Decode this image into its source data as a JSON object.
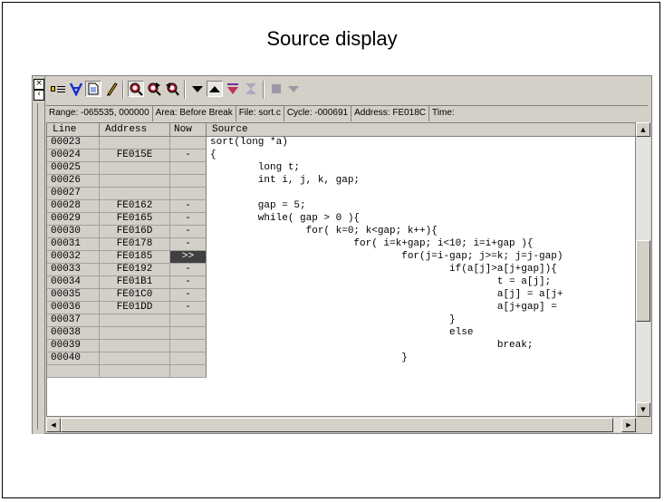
{
  "slide": {
    "title": "Source display"
  },
  "window": {
    "grip": {
      "close_glyph": "×",
      "pin_glyph": "‹"
    },
    "toolbar": {
      "buttons": [
        {
          "icon": "breakpoint-list-icon"
        },
        {
          "icon": "filter-icon"
        },
        {
          "icon": "document-icon"
        },
        {
          "icon": "edit-pencil-icon"
        },
        {
          "icon": "search-icon"
        },
        {
          "icon": "search-forward-icon"
        },
        {
          "icon": "search-back-icon"
        },
        {
          "icon": "arrow-down-icon"
        },
        {
          "icon": "arrow-up-icon"
        },
        {
          "icon": "jump-down-icon"
        },
        {
          "icon": "jump-end-icon"
        },
        {
          "icon": "stop-square-icon"
        },
        {
          "icon": "dropdown-icon"
        }
      ]
    },
    "infobar": {
      "range": "Range: -065535, 000000",
      "area": "Area: Before Break",
      "file": "File: sort.c",
      "cycle": "Cycle: -000691",
      "address": "Address: FE018C",
      "time": "Time:"
    },
    "table": {
      "headers": {
        "line": "Line",
        "address": "Address",
        "now": "Now",
        "source": "Source"
      },
      "rows": [
        {
          "line": "00023",
          "address": "",
          "now": "",
          "source": "sort(long *a)"
        },
        {
          "line": "00024",
          "address": "FE015E",
          "now": "-",
          "source": "{"
        },
        {
          "line": "00025",
          "address": "",
          "now": "",
          "source": "        long t;"
        },
        {
          "line": "00026",
          "address": "",
          "now": "",
          "source": "        int i, j, k, gap;"
        },
        {
          "line": "00027",
          "address": "",
          "now": "",
          "source": ""
        },
        {
          "line": "00028",
          "address": "FE0162",
          "now": "-",
          "source": "        gap = 5;"
        },
        {
          "line": "00029",
          "address": "FE0165",
          "now": "-",
          "source": "        while( gap > 0 ){"
        },
        {
          "line": "00030",
          "address": "FE016D",
          "now": "-",
          "source": "                for( k=0; k<gap; k++){"
        },
        {
          "line": "00031",
          "address": "FE0178",
          "now": "-",
          "source": "                        for( i=k+gap; i<10; i=i+gap ){"
        },
        {
          "line": "00032",
          "address": "FE0185",
          "now": ">>",
          "source": "                                for(j=i-gap; j>=k; j=j-gap)"
        },
        {
          "line": "00033",
          "address": "FE0192",
          "now": "-",
          "source": "                                        if(a[j]>a[j+gap]){"
        },
        {
          "line": "00034",
          "address": "FE01B1",
          "now": "-",
          "source": "                                                t = a[j];"
        },
        {
          "line": "00035",
          "address": "FE01C0",
          "now": "-",
          "source": "                                                a[j] = a[j+"
        },
        {
          "line": "00036",
          "address": "FE01DD",
          "now": "-",
          "source": "                                                a[j+gap] ="
        },
        {
          "line": "00037",
          "address": "",
          "now": "",
          "source": "                                        }"
        },
        {
          "line": "00038",
          "address": "",
          "now": "",
          "source": "                                        else"
        },
        {
          "line": "00039",
          "address": "",
          "now": "",
          "source": "                                                break;"
        },
        {
          "line": "00040",
          "address": "",
          "now": "",
          "source": "                                }"
        },
        {
          "line": "",
          "address": "",
          "now": "",
          "source": ""
        }
      ]
    },
    "scrollbars": {
      "up": "▲",
      "down": "▼",
      "left": "◀",
      "right": "▶"
    }
  }
}
